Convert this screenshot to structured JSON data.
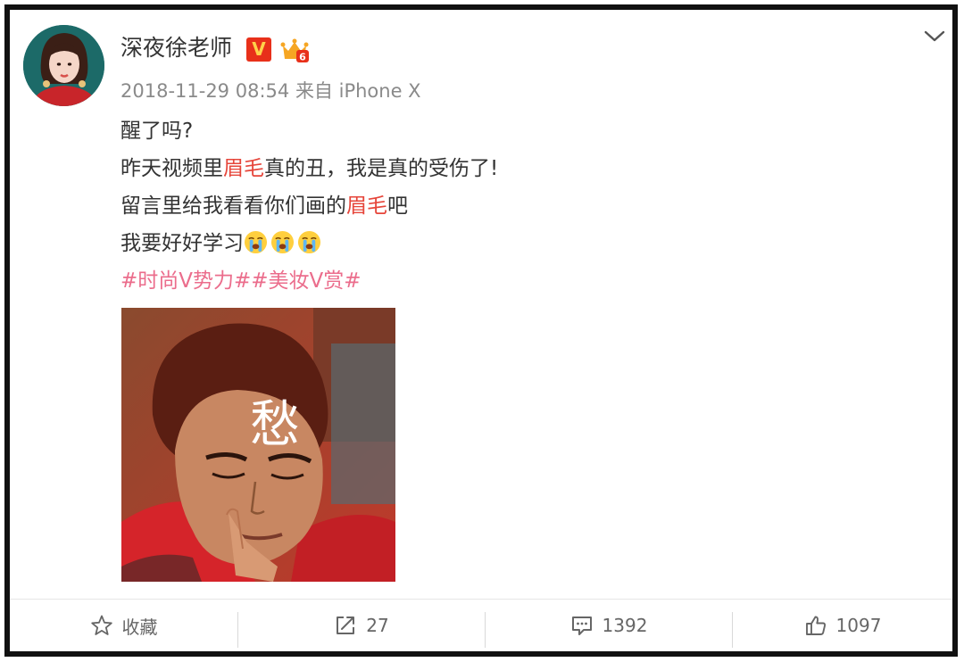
{
  "post": {
    "username": "深夜徐老师",
    "verified_badge": "V",
    "level_badge": "6",
    "timestamp": "2018-11-29 08:54",
    "source_prefix": "来自",
    "source_device": "iPhone X",
    "lines": {
      "l1": "醒了吗?",
      "l2_a": "昨天视频里",
      "l2_hl": "眉毛",
      "l2_b": "真的丑，我是真的受伤了!",
      "l3_a": "留言里给我看看你们画的",
      "l3_hl": "眉毛",
      "l3_b": "吧",
      "l4": "我要好好学习"
    },
    "topics": "#时尚V势力##美妆V赏#",
    "image_caption": "愁",
    "icons": {
      "more": "chevron-down-icon",
      "cry_emoji": "crying-face-icon",
      "favorite": "star-icon",
      "repost": "share-arrow-icon",
      "comment": "comment-icon",
      "like": "thumbs-up-icon"
    }
  },
  "actions": {
    "favorite_label": "收藏",
    "repost_count": "27",
    "comment_count": "1392",
    "like_count": "1097"
  },
  "colors": {
    "highlight": "#e6453a",
    "topic": "#eb6d8c",
    "meta": "#8a8a8a",
    "badge_red": "#e8301a"
  }
}
